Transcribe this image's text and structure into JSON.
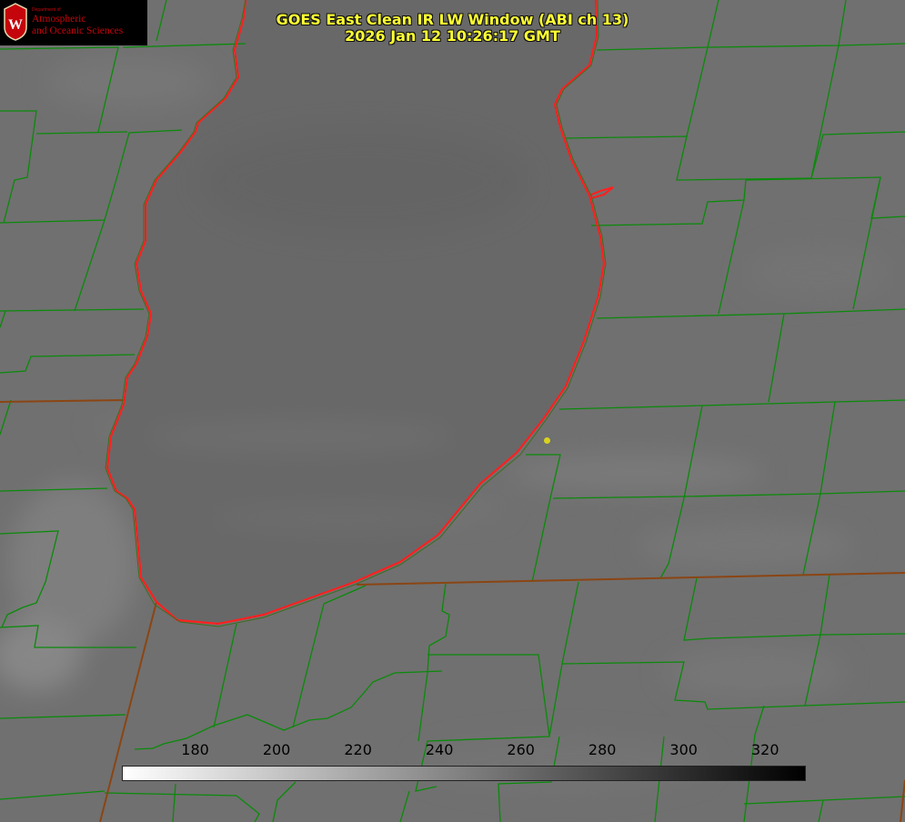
{
  "header": {
    "title_line1": "GOES East Clean IR LW Window (ABI ch 13)",
    "title_line2": "2026 Jan 12 10:26:17 GMT"
  },
  "logo": {
    "department": "Department of",
    "name_line1": "Atmospheric",
    "name_line2": "and Oceanic Sciences",
    "seal_letter": "W",
    "color": "#c5050c"
  },
  "colorbar": {
    "ticks": [
      "180",
      "200",
      "220",
      "240",
      "260",
      "280",
      "300",
      "320"
    ],
    "scale_min": 162,
    "scale_max": 330,
    "gradient": [
      "#ffffff",
      "#000000"
    ]
  },
  "colors": {
    "title": "#ffff33",
    "county_lines": "#0a8a0a",
    "state_border": "#8b4513",
    "lake_shoreline": "#ff2020",
    "marker": "#d8d21e"
  }
}
